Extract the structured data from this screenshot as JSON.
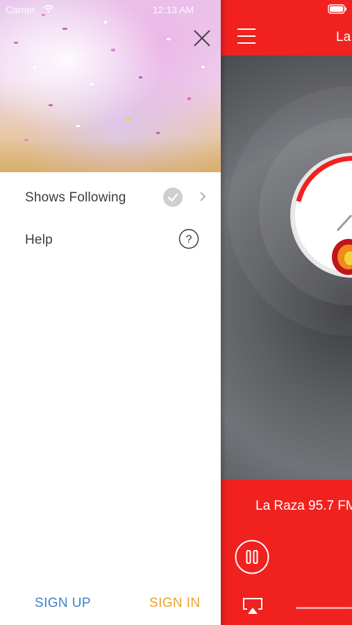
{
  "status": {
    "carrier": "Carrier",
    "time": "12:13 AM"
  },
  "drawer": {
    "menu": [
      {
        "label": "Shows Following"
      },
      {
        "label": "Help"
      }
    ],
    "help_glyph": "?",
    "sign_up": "SIGN UP",
    "sign_in": "SIGN IN"
  },
  "player": {
    "header_title": "La",
    "now_playing": "La Raza 95.7 FM",
    "volume": 0.0
  },
  "colors": {
    "brand_red": "#f0211f",
    "sign_up": "#3f82c7",
    "sign_in": "#e9a32d"
  },
  "icons": [
    "wifi-icon",
    "close-icon",
    "check-icon",
    "chevron-right-icon",
    "help-icon",
    "battery-icon",
    "menu-icon",
    "pause-icon",
    "airplay-icon"
  ]
}
